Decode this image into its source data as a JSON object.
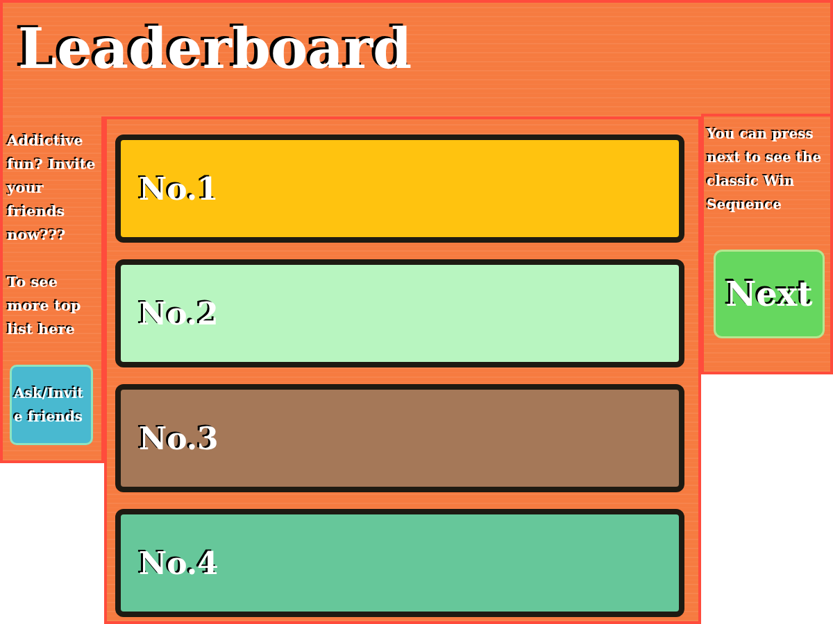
{
  "header": {
    "title": "Leaderboard"
  },
  "left_panel": {
    "paragraphs": [
      "Addictive fun? Invite your friends now???",
      "To see more top list here"
    ],
    "button": "Ask/Invite friends"
  },
  "leaderboard": [
    {
      "label": "No.1",
      "color": "#ffc30f"
    },
    {
      "label": "No.2",
      "color": "#b8f5c0"
    },
    {
      "label": "No.3",
      "color": "#a57858"
    },
    {
      "label": "No.4",
      "color": "#66c79a"
    }
  ],
  "right_panel": {
    "text": "You can press next to see the classic Win Sequence",
    "button": "Next"
  }
}
